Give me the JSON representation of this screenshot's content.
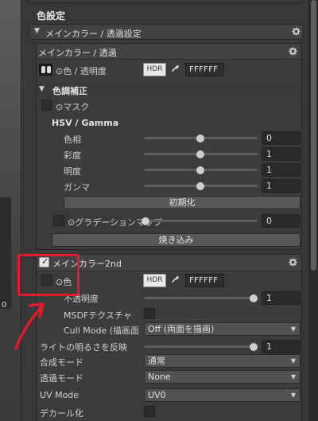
{
  "section_title": "色設定",
  "main_color_group": {
    "header": "メインカラー / 透過設定",
    "subheader": "メインカラー / 透過",
    "color_row": {
      "label": "⊙色 / 透明度",
      "hdr": "HDR",
      "hex": "FFFFFF"
    },
    "tone_correction": {
      "header": "色調補正",
      "mask_label": "⊙マスク",
      "hsv_title": "HSV / Gamma",
      "sliders": [
        {
          "label": "色相",
          "value": "0",
          "fraction": 0.5
        },
        {
          "label": "彩度",
          "value": "1",
          "fraction": 0.5
        },
        {
          "label": "明度",
          "value": "1",
          "fraction": 0.5
        },
        {
          "label": "ガンマ",
          "value": "1",
          "fraction": 0.5
        }
      ],
      "reset_button": "初期化",
      "gradient_map": {
        "label": "⊙グラデーションマップ",
        "value": "0",
        "fraction": 0.0
      },
      "bake_button": "焼き込み"
    }
  },
  "main_color_2nd": {
    "header": "メインカラー2nd",
    "enabled": true,
    "color_row": {
      "label": "⊙色",
      "hdr": "HDR",
      "hex": "FFFFFF"
    },
    "opacity": {
      "label": "不透明度",
      "value": "1",
      "fraction": 1.0
    },
    "msdf": {
      "label": "MSDFテクスチャ",
      "checked": false
    },
    "cull_mode": {
      "label": "Cull Mode (描画面",
      "value": "Off (両面を描画)"
    },
    "light_intensity": {
      "label": "ライトの明るさを反映",
      "value": "1",
      "fraction": 1.0
    },
    "blend_mode": {
      "label": "合成モード",
      "value": "通常"
    },
    "transparency_mode": {
      "label": "透過モード",
      "value": "None"
    },
    "uv_mode": {
      "label": "UV Mode",
      "value": "UV0"
    },
    "decal": {
      "label": "デカール化",
      "checked": false
    }
  },
  "annotation_color": "#e51a2a",
  "icons": [
    "gear-icon",
    "eyedropper-icon",
    "foldout-triangle-icon",
    "dropdown-caret-icon",
    "checkmark-icon",
    "arrow-annotation"
  ]
}
